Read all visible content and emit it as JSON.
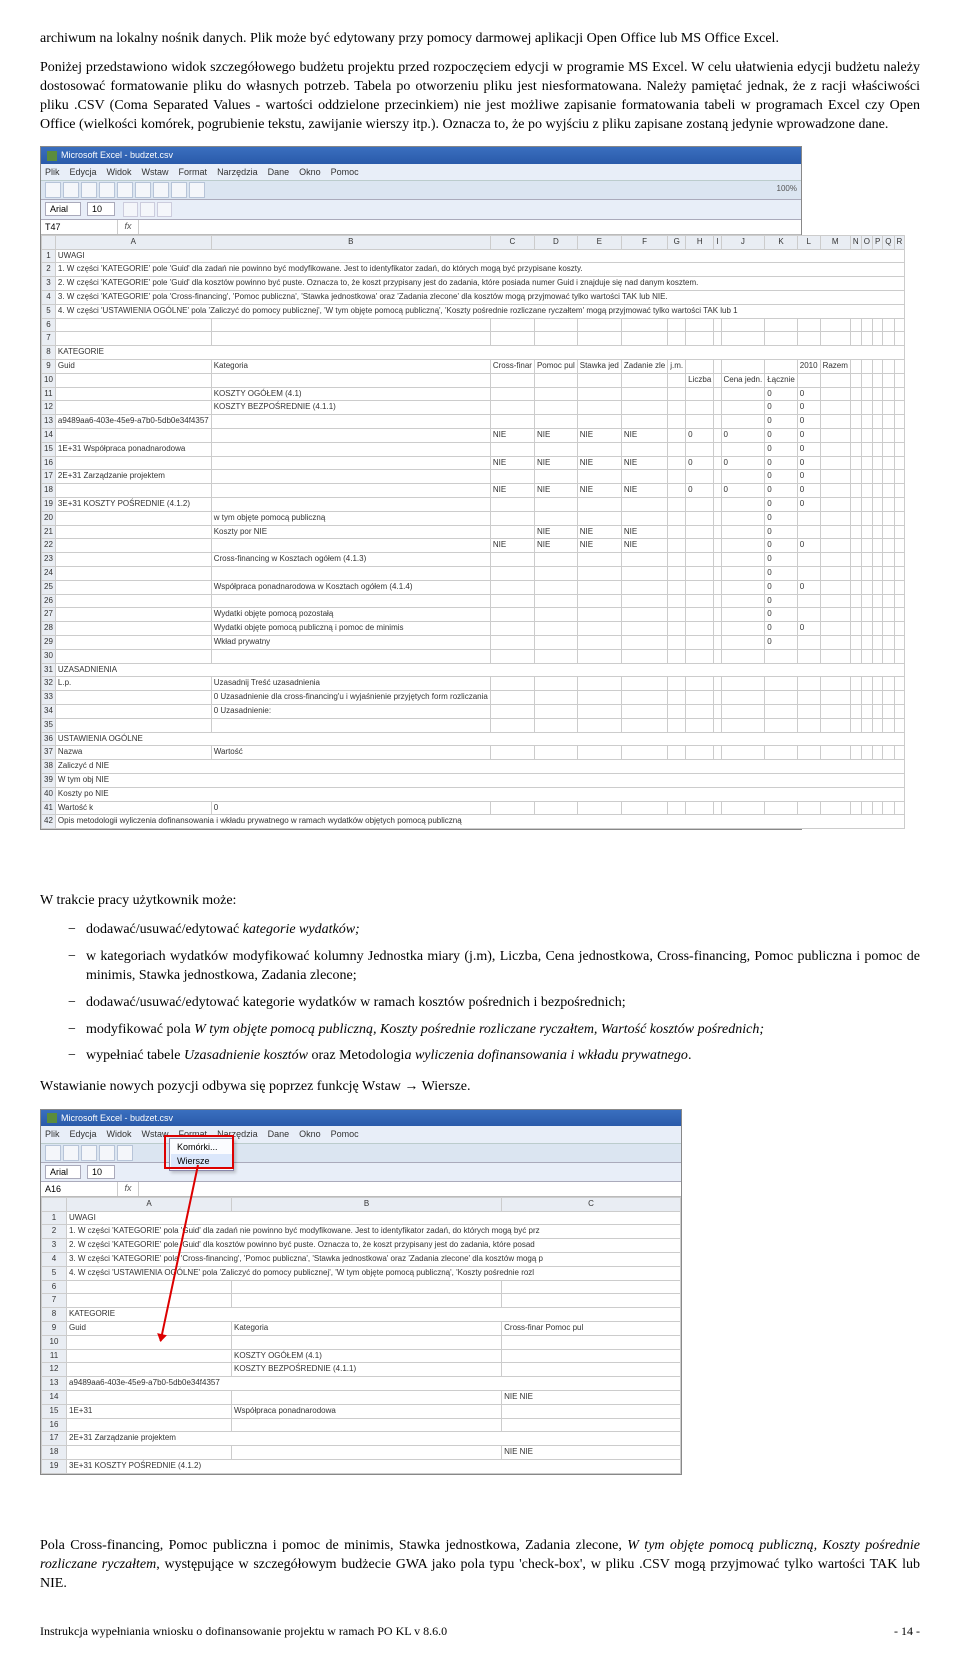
{
  "para1": "archiwum na lokalny nośnik danych. Plik może być edytowany przy pomocy darmowej aplikacji Open Office lub MS Office Excel.",
  "para2": "Poniżej przedstawiono widok szczegółowego budżetu projektu przed rozpoczęciem edycji w programie MS Excel. W celu ułatwienia edycji budżetu należy dostosować formatowanie pliku do własnych potrzeb. Tabela po otworzeniu pliku jest niesformatowana. Należy pamiętać jednak, że z racji właściwości pliku .CSV (Coma Separated Values - wartości oddzielone przecinkiem) nie jest możliwe zapisanie formatowania tabeli w programach Excel czy Open Office (wielkości komórek, pogrubienie tekstu, zawijanie wierszy itp.). Oznacza to, że po wyjściu z pliku zapisane zostaną jedynie wprowadzone dane.",
  "ss1": {
    "title": "Microsoft Excel - budzet.csv",
    "menus": [
      "Plik",
      "Edycja",
      "Widok",
      "Wstaw",
      "Format",
      "Narzędzia",
      "Dane",
      "Okno",
      "Pomoc"
    ],
    "font": "Arial",
    "size": "10",
    "zoom": "100%",
    "cellref": "T47",
    "cols": [
      "",
      "A",
      "B",
      "C",
      "D",
      "E",
      "F",
      "G",
      "H",
      "I",
      "J",
      "K",
      "L",
      "M",
      "N",
      "O",
      "P",
      "Q",
      "R"
    ],
    "rows": [
      [
        "1",
        "UWAGI"
      ],
      [
        "2",
        "1. W części 'KATEGORIE' pole 'Guid' dla zadań nie powinno być modyfikowane. Jest to identyfikator zadań, do których mogą być przypisane koszty."
      ],
      [
        "3",
        "2. W części 'KATEGORIE' pole 'Guid' dla kosztów powinno być puste. Oznacza to, że koszt przypisany jest do zadania, które posiada numer Guid i znajduje się nad danym kosztem."
      ],
      [
        "4",
        "3. W części 'KATEGORIE' pola 'Cross-financing', 'Pomoc publiczna', 'Stawka jednostkowa' oraz 'Zadania zlecone' dla kosztów mogą przyjmować tylko wartości TAK lub NIE."
      ],
      [
        "5",
        "4. W części 'USTAWIENIA OGÓLNE' pola 'Zaliczyć do pomocy publicznej', 'W tym objęte pomocą publiczną', 'Koszty pośrednie rozliczane ryczałtem' mogą przyjmować tylko wartości TAK lub 1"
      ],
      [
        "6",
        ""
      ],
      [
        "7",
        ""
      ],
      [
        "8",
        "KATEGORIE"
      ],
      [
        "9",
        "Guid",
        "Kategoria",
        "Cross-finar",
        "Pomoc pul",
        "Stawka jed",
        "Zadanie zle",
        "j.m.",
        "",
        "",
        "",
        "",
        "2010",
        "Razem"
      ],
      [
        "10",
        "",
        "",
        "",
        "",
        "",
        "",
        "",
        "Liczba",
        "",
        "Cena jedn.",
        "Łącznie"
      ],
      [
        "11",
        "",
        "KOSZTY OGÓŁEM (4.1)",
        "",
        "",
        "",
        "",
        "",
        "",
        "",
        "",
        "0",
        "0"
      ],
      [
        "12",
        "",
        "KOSZTY BEZPOŚREDNIE (4.1.1)",
        "",
        "",
        "",
        "",
        "",
        "",
        "",
        "",
        "0",
        "0"
      ],
      [
        "13",
        "a9489aa6-403e-45e9-a7b0-5db0e34f4357",
        "",
        "",
        "",
        "",
        "",
        "",
        "",
        "",
        "",
        "0",
        "0"
      ],
      [
        "14",
        "",
        "",
        "NIE",
        "NIE",
        "NIE",
        "NIE",
        "",
        "0",
        "",
        "0",
        "0",
        "0"
      ],
      [
        "15",
        "1E+31 Współpraca ponadnarodowa",
        "",
        "",
        "",
        "",
        "",
        "",
        "",
        "",
        "",
        "0",
        "0"
      ],
      [
        "16",
        "",
        "",
        "NIE",
        "NIE",
        "NIE",
        "NIE",
        "",
        "0",
        "",
        "0",
        "0",
        "0"
      ],
      [
        "17",
        "2E+31 Zarządzanie projektem",
        "",
        "",
        "",
        "",
        "",
        "",
        "",
        "",
        "",
        "0",
        "0"
      ],
      [
        "18",
        "",
        "",
        "NIE",
        "NIE",
        "NIE",
        "NIE",
        "",
        "0",
        "",
        "0",
        "0",
        "0"
      ],
      [
        "19",
        "3E+31 KOSZTY POŚREDNIE (4.1.2)",
        "",
        "",
        "",
        "",
        "",
        "",
        "",
        "",
        "",
        "0",
        "0"
      ],
      [
        "20",
        "",
        "w tym objęte pomocą publiczną",
        "",
        "",
        "",
        "",
        "",
        "",
        "",
        "",
        "0"
      ],
      [
        "21",
        "",
        "Koszty por NIE",
        "",
        "NIE",
        "NIE",
        "NIE",
        "",
        "",
        "",
        "",
        "0"
      ],
      [
        "22",
        "",
        "",
        "NIE",
        "NIE",
        "NIE",
        "NIE",
        "",
        "",
        "",
        "",
        "0",
        "0"
      ],
      [
        "23",
        "",
        "Cross-financing w Kosztach ogółem (4.1.3)",
        "",
        "",
        "",
        "",
        "",
        "",
        "",
        "",
        "0"
      ],
      [
        "24",
        "",
        "",
        "",
        "",
        "",
        "",
        "",
        "",
        "",
        "",
        "0"
      ],
      [
        "25",
        "",
        "Współpraca ponadnarodowa w Kosztach ogółem (4.1.4)",
        "",
        "",
        "",
        "",
        "",
        "",
        "",
        "",
        "0",
        "0"
      ],
      [
        "26",
        "",
        "",
        "",
        "",
        "",
        "",
        "",
        "",
        "",
        "",
        "0"
      ],
      [
        "27",
        "",
        "Wydatki objęte pomocą pozostałą",
        "",
        "",
        "",
        "",
        "",
        "",
        "",
        "",
        "0"
      ],
      [
        "28",
        "",
        "Wydatki objęte pomocą publiczną i pomoc de minimis",
        "",
        "",
        "",
        "",
        "",
        "",
        "",
        "",
        "0",
        "0"
      ],
      [
        "29",
        "",
        "Wkład prywatny",
        "",
        "",
        "",
        "",
        "",
        "",
        "",
        "",
        "0"
      ],
      [
        "30",
        ""
      ],
      [
        "31",
        "UZASADNIENIA"
      ],
      [
        "32",
        "L.p.",
        "Uzasadnij Treść uzasadnienia"
      ],
      [
        "33",
        "",
        "0  Uzasadnienie dla cross-financing'u i wyjaśnienie przyjętych form rozliczania"
      ],
      [
        "34",
        "",
        "0  Uzasadnienie:"
      ],
      [
        "35",
        ""
      ],
      [
        "36",
        "USTAWIENIA OGÓLNE"
      ],
      [
        "37",
        "Nazwa",
        "Wartość"
      ],
      [
        "38",
        "Zaliczyć d NIE"
      ],
      [
        "39",
        "W tym obj NIE"
      ],
      [
        "40",
        "Koszty po NIE"
      ],
      [
        "41",
        "Wartość k",
        "0"
      ],
      [
        "42",
        "Opis metodologii wyliczenia dofinansowania i wkładu prywatnego w ramach wydatków objętych pomocą publiczną"
      ]
    ]
  },
  "para3": "W trakcie pracy użytkownik może:",
  "bullets": [
    {
      "plain": "dodawać/usuwać/edytować ",
      "italic": "kategorie wydatków;"
    },
    {
      "plain": "w kategoriach wydatków modyfikować kolumny Jednostka miary (j.m), Liczba, Cena jednostkowa, Cross-financing, Pomoc publiczna i pomoc de minimis, Stawka jednostkowa, Zadania zlecone;",
      "italic": ""
    },
    {
      "plain": "dodawać/usuwać/edytować kategorie wydatków w ramach kosztów pośrednich i bezpośrednich;",
      "italic": ""
    },
    {
      "plain": "modyfikować pola ",
      "italic": "W tym objęte pomocą publiczną, Koszty pośrednie rozliczane ryczałtem, Wartość kosztów pośrednich;"
    },
    {
      "plain": "wypełniać tabele ",
      "italic": "Uzasadnienie kosztów",
      "plain2": " oraz Metodologi",
      "italic2": "a wyliczenia dofinansowania i wkładu prywatnego",
      "plain3": "."
    }
  ],
  "para4": "Wstawianie nowych pozycji odbywa się poprzez funkcję Wstaw → Wiersze.",
  "ss2": {
    "title": "Microsoft Excel - budzet.csv",
    "cellref": "A16",
    "submenu": [
      "Komórki...",
      "Wiersze"
    ],
    "cols": [
      "",
      "A",
      "B",
      "C"
    ],
    "rows": [
      [
        "1",
        "UWAGI"
      ],
      [
        "2",
        "1. W części 'KATEGORIE' pola 'Guid' dla zadań nie powinno być modyfikowane. Jest to identyfikator zadań, do których mogą być prz"
      ],
      [
        "3",
        "2. W części 'KATEGORIE' pole 'Guid' dla kosztów powinno być puste. Oznacza to, że koszt przypisany jest do zadania, które posad"
      ],
      [
        "4",
        "3. W części 'KATEGORIE' pola 'Cross-financing', 'Pomoc publiczna', 'Stawka jednostkowa' oraz 'Zadania zlecone' dla kosztów mogą p"
      ],
      [
        "5",
        "4. W części 'USTAWIENIA OGÓLNE' pola 'Zaliczyć do pomocy publicznej', 'W tym objęte pomocą publiczną', 'Koszty pośrednie rozl"
      ],
      [
        "6",
        ""
      ],
      [
        "7",
        ""
      ],
      [
        "8",
        "KATEGORIE"
      ],
      [
        "9",
        "Guid",
        "Kategoria",
        "Cross-finar Pomoc pul"
      ],
      [
        "10",
        ""
      ],
      [
        "11",
        "",
        "KOSZTY OGÓŁEM (4.1)"
      ],
      [
        "12",
        "",
        "KOSZTY BEZPOŚREDNIE (4.1.1)"
      ],
      [
        "13",
        "a9489aa6-403e-45e9-a7b0-5db0e34f4357"
      ],
      [
        "14",
        "",
        "",
        "NIE   NIE"
      ],
      [
        "15",
        "1E+31",
        "Współpraca ponadnarodowa"
      ],
      [
        "16",
        ""
      ],
      [
        "17",
        "2E+31 Zarządzanie projektem"
      ],
      [
        "18",
        "",
        "",
        "NIE   NIE"
      ],
      [
        "19",
        "3E+31 KOSZTY POŚREDNIE (4.1.2)"
      ]
    ]
  },
  "para5_a": "Pola Cross-financing, Pomoc publiczna i pomoc de minimis, Stawka jednostkowa, Zadania zlecone, ",
  "para5_i": "W tym objęte pomocą publiczną, Koszty pośrednie rozliczane ryczałtem",
  "para5_b": ", występujące w szczegółowym budżecie GWA jako pola typu 'check-box', w pliku .CSV mogą przyjmować tylko wartości TAK lub NIE.",
  "footer_left": "Instrukcja wypełniania wniosku o dofinansowanie projektu w ramach PO KL v 8.6.0",
  "footer_right": "- 14 -"
}
